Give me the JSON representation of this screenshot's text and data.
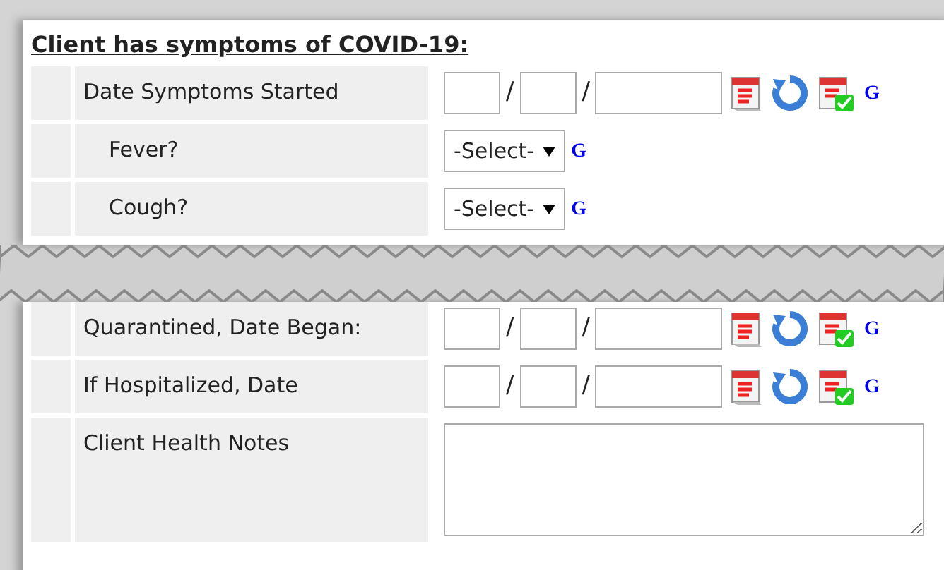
{
  "heading": "Client has symptoms of COVID-19:",
  "sections": [
    {
      "rows": [
        {
          "label": "Date Symptoms Started",
          "indent": false,
          "kind": "date",
          "separators": [
            "/",
            "/"
          ],
          "link": "G"
        },
        {
          "label": "Fever?",
          "indent": true,
          "kind": "select",
          "value": "-Select-",
          "link": "G"
        },
        {
          "label": "Cough?",
          "indent": true,
          "kind": "select",
          "value": "-Select-",
          "link": "G"
        }
      ]
    },
    {
      "rows": [
        {
          "label": "Quarantined, Date Began:",
          "indent": false,
          "kind": "date",
          "separators": [
            "/",
            "/"
          ],
          "link": "G"
        },
        {
          "label": "If Hospitalized, Date",
          "indent": false,
          "kind": "date",
          "separators": [
            "/",
            "/"
          ],
          "link": "G"
        },
        {
          "label": "Client Health Notes",
          "indent": false,
          "kind": "textarea"
        }
      ]
    }
  ]
}
